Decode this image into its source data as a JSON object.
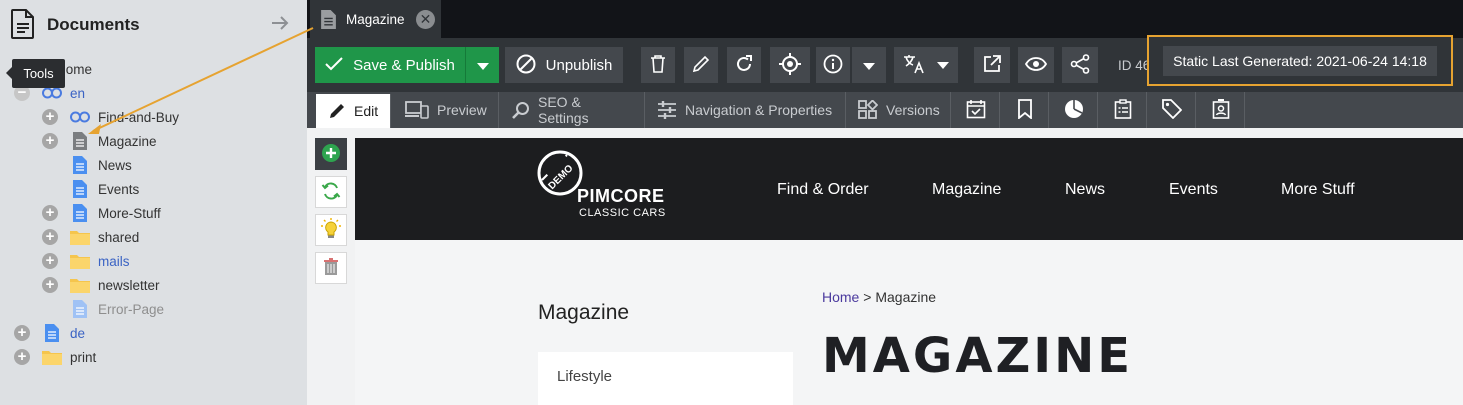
{
  "sidebar": {
    "title": "Documents",
    "tooltip": "Tools",
    "tree": [
      {
        "label": "Home"
      },
      {
        "label": "en"
      },
      {
        "label": "Find-and-Buy"
      },
      {
        "label": "Magazine"
      },
      {
        "label": "News"
      },
      {
        "label": "Events"
      },
      {
        "label": "More-Stuff"
      },
      {
        "label": "shared"
      },
      {
        "label": "mails"
      },
      {
        "label": "newsletter"
      },
      {
        "label": "Error-Page"
      },
      {
        "label": "de"
      },
      {
        "label": "print"
      }
    ]
  },
  "tab": {
    "label": "Magazine"
  },
  "toolbar": {
    "save_publish": "Save & Publish",
    "unpublish": "Unpublish",
    "id_label": "ID 46",
    "static_generated": "Static Last Generated: 2021-06-24 14:18"
  },
  "subtabs": {
    "edit": "Edit",
    "preview": "Preview",
    "seo": "SEO & Settings",
    "navigation": "Navigation & Properties",
    "versions": "Versions"
  },
  "site": {
    "logo_badge": "DEMO",
    "logo_name": "PIMCORE",
    "logo_sub": "CLASSIC CARS",
    "nav": [
      "Find & Order",
      "Magazine",
      "News",
      "Events",
      "More Stuff"
    ],
    "sidebar_title": "Magazine",
    "sidebar_item": "Lifestyle",
    "breadcrumb_home": "Home",
    "breadcrumb_sep": ">",
    "breadcrumb_current": "Magazine",
    "page_title": "MAGAZINE"
  },
  "colors": {
    "accent_green": "#1f9649",
    "highlight_orange": "#e6a331",
    "link_blue": "#3a63c4"
  }
}
